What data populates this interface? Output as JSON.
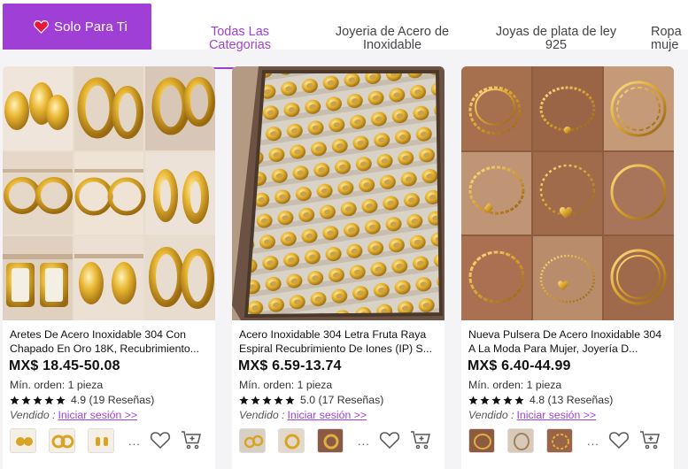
{
  "nav": {
    "solo_label": "Solo Para Ti",
    "tabs": [
      {
        "label": "Todas Las\nCategorias",
        "active": true
      },
      {
        "label": "Joyeria de Acero de\nInoxidable",
        "active": false
      },
      {
        "label": "Joyas de plata de ley\n925",
        "active": false
      },
      {
        "label": "Ropa\nmuje",
        "active": false
      }
    ]
  },
  "products": [
    {
      "title": "Aretes De Acero Inoxidable 304 Con Chapado En Oro 18K, Recubrimiento...",
      "price": "MX$ 18.45-50.08",
      "min_order": "Mín. orden: 1 pieza",
      "rating_text": "4.9 (19 Reseñas)",
      "seller_label": "Vendido :",
      "login_link": "Iniciar sesión >>",
      "more": "..."
    },
    {
      "title": "Acero Inoxidable 304 Letra Fruta Raya Espiral Recubrimiento De Iones (IP) S...",
      "price": "MX$ 6.59-13.74",
      "min_order": "Mín. orden: 1 pieza",
      "rating_text": "5.0 (17 Reseñas)",
      "seller_label": "Vendido :",
      "login_link": "Iniciar sesión >>",
      "more": "..."
    },
    {
      "title": "Nueva Pulsera De Acero Inoxidable 304 A La Moda Para Mujer, Joyería D...",
      "price": "MX$ 6.40-44.99",
      "min_order": "Mín. orden: 1 pieza",
      "rating_text": "4.8 (13 Reseñas)",
      "seller_label": "Vendido :",
      "login_link": "Iniciar sesión >>",
      "more": "..."
    }
  ],
  "icons": {
    "heart": "heart-icon",
    "star": "star-icon",
    "favorite": "heart-outline-icon",
    "cart": "add-to-cart-icon"
  },
  "colors": {
    "accent": "#9f3fd6",
    "gold": "#d9a425",
    "heart": "#e8173a"
  }
}
